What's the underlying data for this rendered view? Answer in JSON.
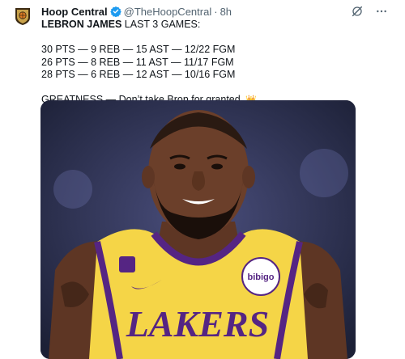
{
  "tweet": {
    "author": {
      "display_name": "Hoop Central",
      "handle": "@TheHoopCentral",
      "verified": true,
      "avatar_icon": "hoop-central-logo"
    },
    "separator": "·",
    "timestamp": "8h",
    "body": {
      "line1_bold": "LEBRON JAMES",
      "line1_rest": " LAST 3 GAMES:",
      "games": [
        "30 PTS — 9 REB — 15 AST — 12/22 FGM",
        "26 PTS — 8 REB — 11 AST — 11/17 FGM",
        "28 PTS — 6 REB — 12 AST — 10/16 FGM"
      ],
      "closing": "GREATNESS — Don’t take Bron for granted.",
      "closing_emoji": "👑"
    },
    "media": {
      "jersey_text": "LAKERS",
      "patch_text": "bibigo",
      "colors": {
        "jersey": "#f5d547",
        "trim": "#552583",
        "skin": "#6b3f2a"
      }
    },
    "action_icons": [
      "grok-icon",
      "more-icon"
    ]
  }
}
